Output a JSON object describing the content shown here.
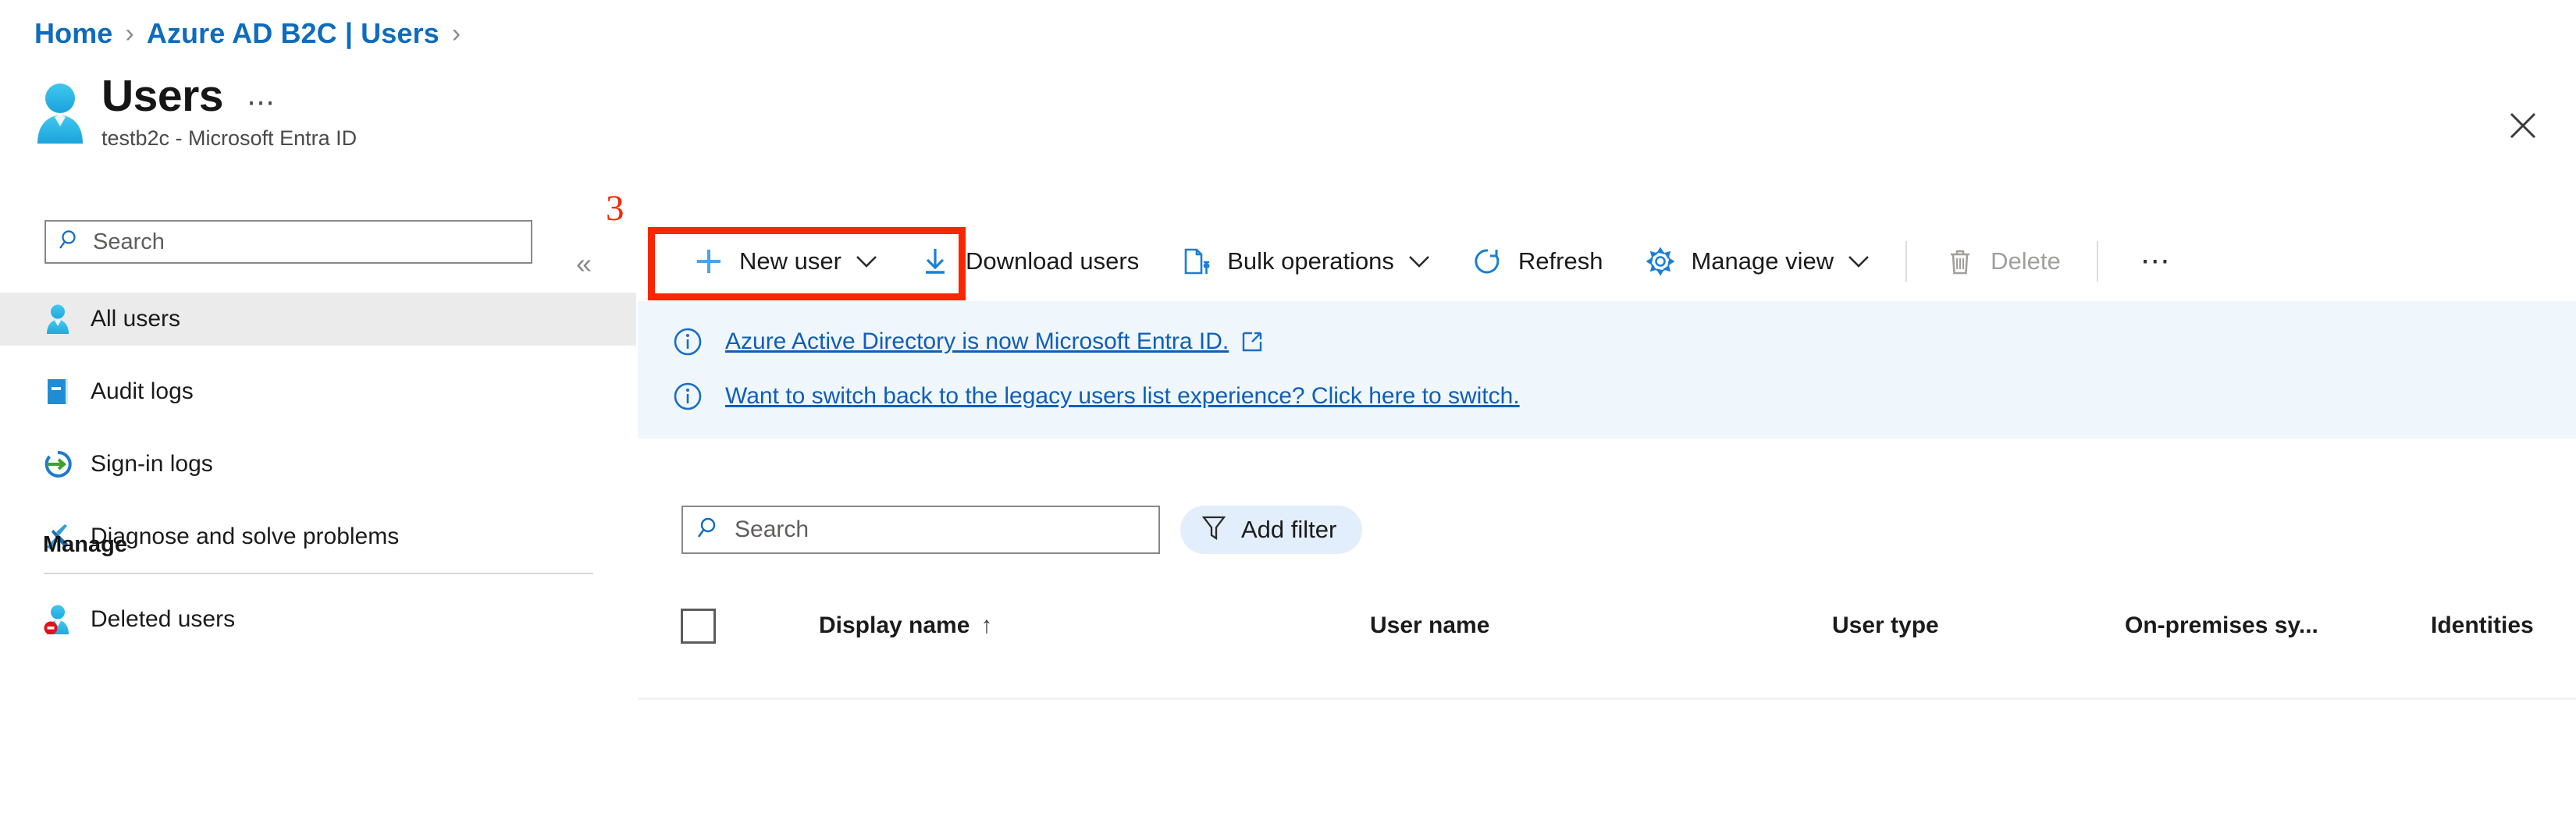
{
  "breadcrumb": {
    "items": [
      {
        "label": "Home"
      },
      {
        "label": "Azure AD B2C | Users"
      }
    ],
    "separator": "›"
  },
  "header": {
    "title": "Users",
    "subtitle": "testb2c - Microsoft Entra ID",
    "ellipsis_label": "⋯",
    "avatar_icon": "user-avatar-icon",
    "close_icon": "close-icon"
  },
  "sidebar": {
    "search": {
      "placeholder": "Search",
      "value": "",
      "icon": "search-icon"
    },
    "collapse_icon": "«",
    "items": [
      {
        "label": "All users",
        "icon": "user-icon",
        "selected": true
      },
      {
        "label": "Audit logs",
        "icon": "book-icon",
        "selected": false
      },
      {
        "label": "Sign-in logs",
        "icon": "sign-in-icon",
        "selected": false
      },
      {
        "label": "Diagnose and solve problems",
        "icon": "tools-icon",
        "selected": false
      }
    ],
    "group_label": "Manage",
    "manage_items": [
      {
        "label": "Deleted users",
        "icon": "deleted-user-icon",
        "selected": false
      }
    ]
  },
  "toolbar": {
    "new_user": {
      "label": "New user",
      "icon": "plus-icon",
      "caret": "chevron-down-icon"
    },
    "download_users": {
      "label": "Download users",
      "icon": "download-icon"
    },
    "bulk_operations": {
      "label": "Bulk operations",
      "icon": "bulk-operations-icon",
      "caret": "chevron-down-icon"
    },
    "refresh": {
      "label": "Refresh",
      "icon": "refresh-icon"
    },
    "manage_view": {
      "label": "Manage view",
      "icon": "gear-icon",
      "caret": "chevron-down-icon"
    },
    "delete": {
      "label": "Delete",
      "icon": "trash-icon",
      "disabled": true
    },
    "overflow_label": "⋯"
  },
  "annotation": {
    "number": "3",
    "color": "#fa2600",
    "target": "New user"
  },
  "banners": [
    {
      "icon": "info-icon",
      "text": "Azure Active Directory is now Microsoft Entra ID.",
      "external_link_icon": "external-link-icon",
      "has_external_icon": true
    },
    {
      "icon": "info-icon",
      "text": "Want to switch back to the legacy users list experience? Click here to switch.",
      "has_external_icon": false
    }
  ],
  "filters": {
    "search": {
      "placeholder": "Search",
      "value": "",
      "icon": "search-icon"
    },
    "add_filter": {
      "label": "Add filter",
      "icon": "filter-icon"
    }
  },
  "table": {
    "select_all_checked": false,
    "columns": [
      {
        "label": "Display name",
        "sort": "↑",
        "sorted": true
      },
      {
        "label": "User name",
        "sort": "",
        "sorted": false
      },
      {
        "label": "User type",
        "sort": "",
        "sorted": false
      },
      {
        "label": "On-premises sy...",
        "sort": "",
        "sorted": false
      },
      {
        "label": "Identities",
        "sort": "",
        "sorted": false
      }
    ],
    "rows": []
  },
  "colors": {
    "accent": "#0f6cbd",
    "link": "#0f5fb8",
    "banner_bg": "#eff6fc",
    "selected_nav_bg": "#ebebeb",
    "annotation_red": "#fa2600",
    "filter_pill_bg": "#e2eefb"
  }
}
